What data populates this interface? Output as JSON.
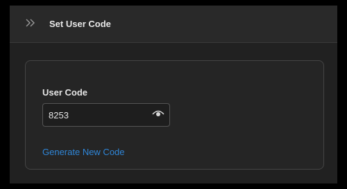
{
  "header": {
    "title": "Set User Code"
  },
  "form": {
    "user_code_label": "User Code",
    "user_code_value": "8253",
    "generate_link": "Generate New Code"
  },
  "icons": {
    "collapse": "chevrons-right-icon",
    "visibility": "eye-icon"
  },
  "colors": {
    "background": "#212121",
    "header": "#292929",
    "card_border": "#454545",
    "link": "#2f86d8"
  }
}
